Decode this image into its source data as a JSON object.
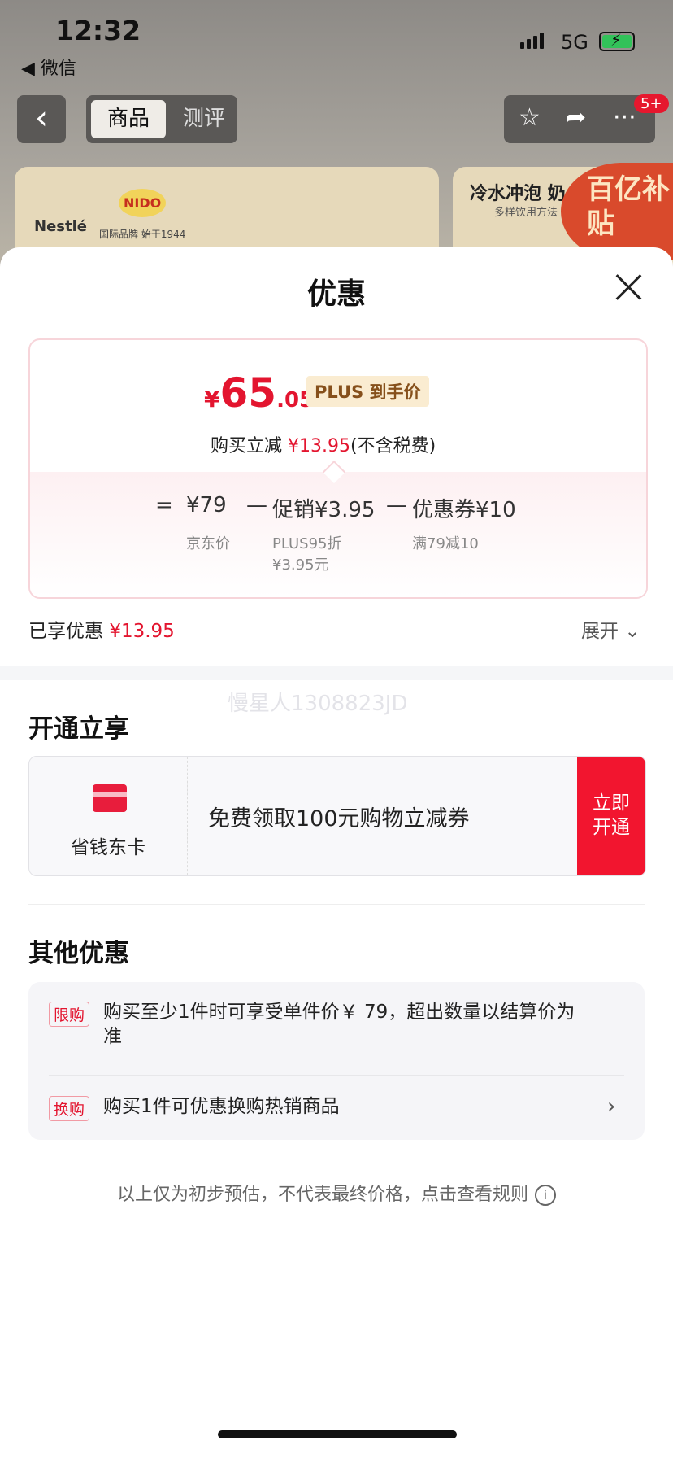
{
  "status": {
    "time": "12:32",
    "back_app": "◀ 微信",
    "network": "5G"
  },
  "nav": {
    "tab_active": "商品",
    "tab_other": "测评",
    "badge": "5+"
  },
  "banner": {
    "brand": "Nestlé",
    "sub_brand": "NIDO",
    "brand_note": "国际品牌 始于1944",
    "right_title": "冷水冲泡 奶",
    "right_sub": "多样饮用方法",
    "subsidy": "百亿补贴"
  },
  "sheet": {
    "title": "优惠",
    "price": {
      "yen": "¥",
      "int": "65",
      "dec": ".05",
      "tag": "PLUS 到手价"
    },
    "reduce": {
      "label": "购买立减",
      "amount": "¥13.95",
      "note": "(不含税费)"
    },
    "calc": {
      "eq": "=",
      "base": "¥79",
      "base_label": "京东价",
      "minus1": "—",
      "promo": "促销¥3.95",
      "promo_label1": "PLUS95折",
      "promo_label2": "¥3.95元",
      "minus2": "—",
      "coupon": "优惠券¥10",
      "coupon_label": "满79减10"
    },
    "enjoyed": {
      "label": "已享优惠",
      "amount": "¥13.95"
    },
    "expand": "展开",
    "watermark": "慢星人1308823JD",
    "open_section": {
      "title": "开通立享",
      "card_name": "省钱东卡",
      "desc": "免费领取100元购物立减券",
      "button_line1": "立即",
      "button_line2": "开通"
    },
    "other_section": {
      "title": "其他优惠",
      "items": [
        {
          "tag": "限购",
          "text": "购买至少1件时可享受单件价￥ 79，超出数量以结算价为准"
        },
        {
          "tag": "换购",
          "text": "购买1件可优惠换购热销商品"
        }
      ]
    },
    "footer": "以上仅为初步预估，不代表最终价格，点击查看规则"
  }
}
